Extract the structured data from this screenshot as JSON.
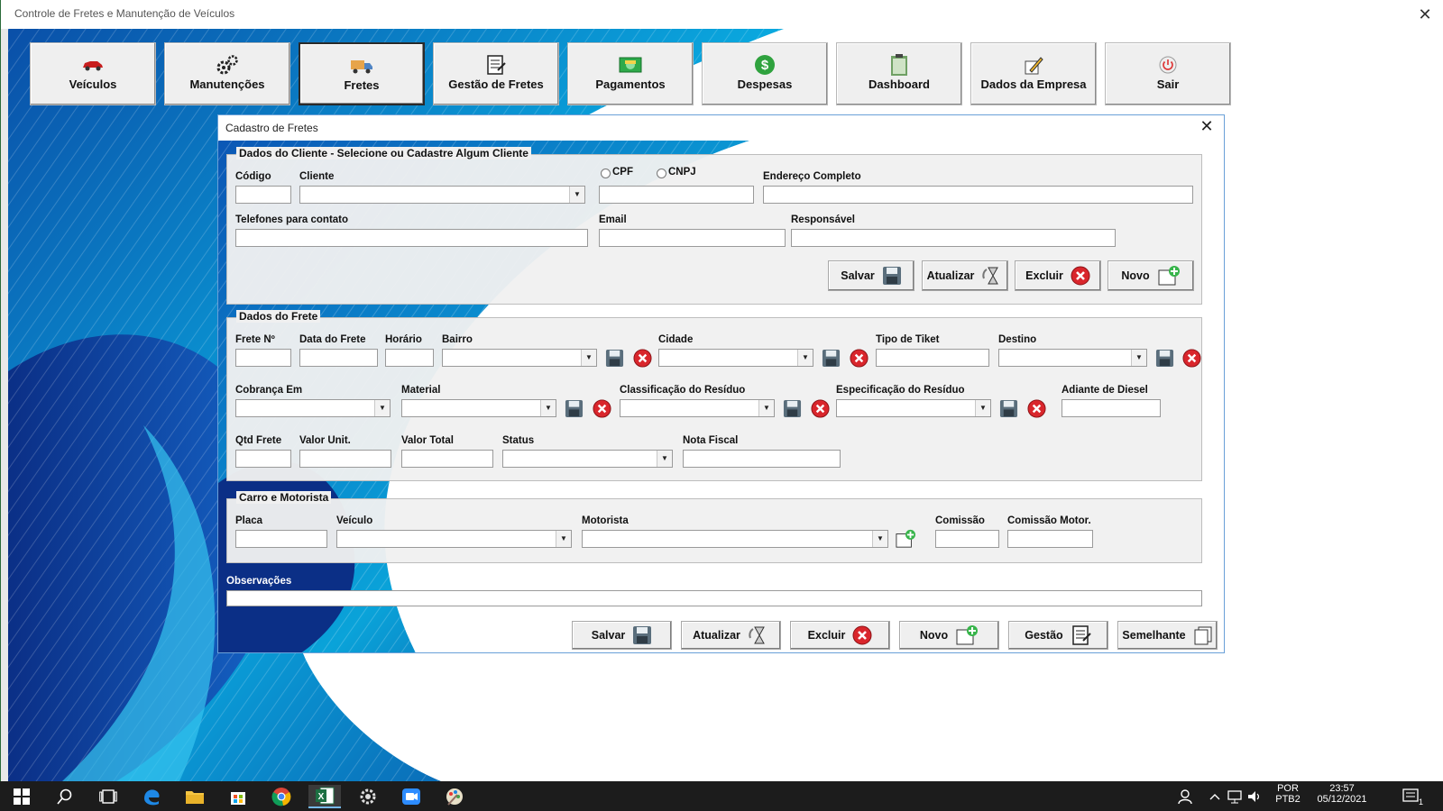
{
  "app": {
    "title": "Controle de Fretes e Manutenção de Veículos",
    "close": "✕"
  },
  "menu": [
    {
      "label": "Veículos",
      "icon": "car-icon"
    },
    {
      "label": "Manutenções",
      "icon": "gears-icon"
    },
    {
      "label": "Fretes",
      "icon": "truck-icon",
      "active": true
    },
    {
      "label": "Gestão de Fretes",
      "icon": "document-list-icon"
    },
    {
      "label": "Pagamentos",
      "icon": "money-icon"
    },
    {
      "label": "Despesas",
      "icon": "dollar-coin-icon"
    },
    {
      "label": "Dashboard",
      "icon": "clipboard-icon"
    },
    {
      "label": "Dados da Empresa",
      "icon": "pencil-paper-icon"
    },
    {
      "label": "Sair",
      "icon": "power-icon"
    }
  ],
  "dialog": {
    "title": "Cadastro de Fretes",
    "close": "✕",
    "cliente": {
      "legend": "Dados do Cliente - Selecione ou Cadastre Algum Cliente",
      "codigo": "Código",
      "cliente": "Cliente",
      "cpf": "CPF",
      "cnpj": "CNPJ",
      "endereco": "Endereço Completo",
      "telefones": "Telefones para contato",
      "email": "Email",
      "responsavel": "Responsável",
      "buttons": {
        "salvar": "Salvar",
        "atualizar": "Atualizar",
        "excluir": "Excluir",
        "novo": "Novo"
      }
    },
    "frete": {
      "legend": "Dados do Frete",
      "frete_no": "Frete Nº",
      "data": "Data do Frete",
      "horario": "Horário",
      "bairro": "Bairro",
      "cidade": "Cidade",
      "tipo_tiket": "Tipo de Tiket",
      "destino": "Destino",
      "cobranca": "Cobrança Em",
      "material": "Material",
      "classificacao": "Classificação do Resíduo",
      "especificacao": "Especificação do Resíduo",
      "adiante_diesel": "Adiante de Diesel",
      "qtd_frete": "Qtd Frete",
      "valor_unit": "Valor Unit.",
      "valor_total": "Valor Total",
      "status": "Status",
      "nota_fiscal": "Nota Fiscal"
    },
    "carro": {
      "legend": "Carro e Motorista",
      "placa": "Placa",
      "veiculo": "Veículo",
      "motorista": "Motorista",
      "comissao": "Comissão",
      "comissao_motor": "Comissão Motor."
    },
    "observacoes": "Observações",
    "bottom_buttons": {
      "salvar": "Salvar",
      "atualizar": "Atualizar",
      "excluir": "Excluir",
      "novo": "Novo",
      "gestao": "Gestão",
      "semelhante": "Semelhante"
    }
  },
  "taskbar": {
    "lang_top": "POR",
    "lang_bottom": "PTB2",
    "time": "23:57",
    "date": "05/12/2021",
    "notifications": "1"
  },
  "colors": {
    "accent_blue": "#0a68c4",
    "bg_teal": "#00a8d8",
    "delete_red": "#d9262c"
  }
}
